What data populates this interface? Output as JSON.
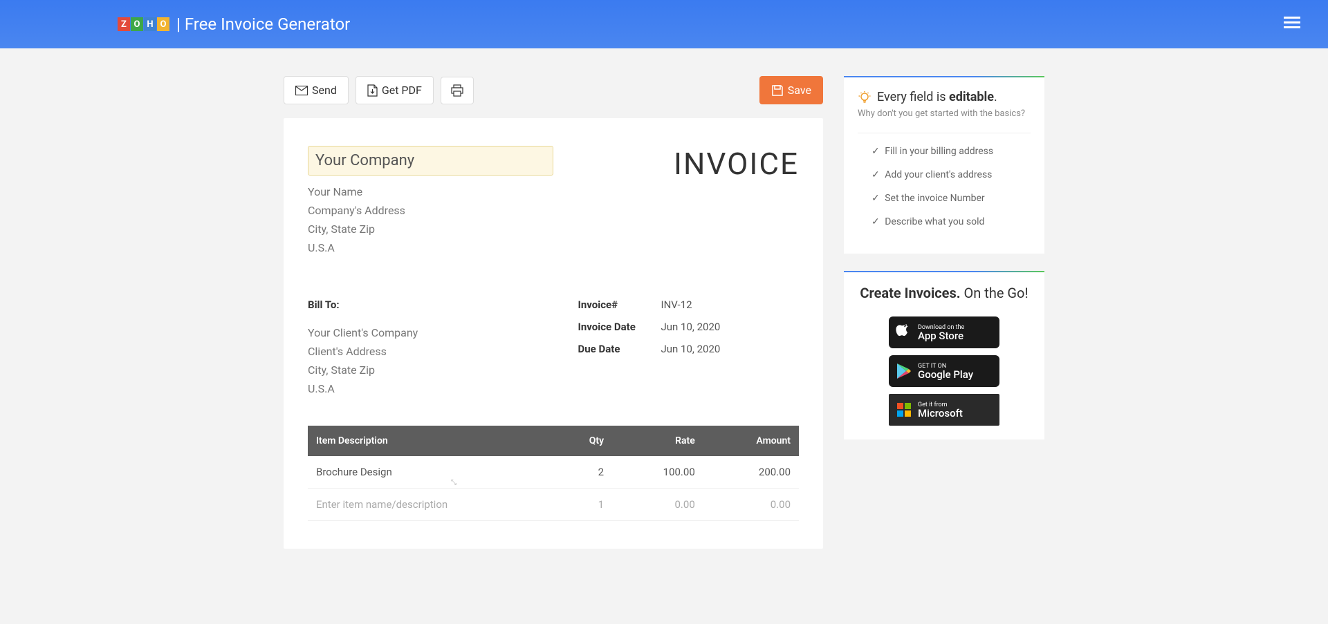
{
  "header": {
    "logo_letters": [
      "Z",
      "O",
      "H",
      "O"
    ],
    "title": "| Free Invoice Generator"
  },
  "toolbar": {
    "send": "Send",
    "get_pdf": "Get PDF",
    "save": "Save"
  },
  "invoice": {
    "company_placeholder": "Your Company",
    "your_name": "Your Name",
    "company_address": "Company's Address",
    "city_state_zip": "City, State Zip",
    "country": "U.S.A",
    "title": "INVOICE",
    "bill_to_label": "Bill To:",
    "client_company": "Your Client's Company",
    "client_address": "Client's Address",
    "client_city": "City, State Zip",
    "client_country": "U.S.A",
    "meta": {
      "number_label": "Invoice#",
      "number_value": "INV-12",
      "date_label": "Invoice Date",
      "date_value": "Jun 10, 2020",
      "due_label": "Due Date",
      "due_value": "Jun 10, 2020"
    },
    "table": {
      "headers": {
        "desc": "Item Description",
        "qty": "Qty",
        "rate": "Rate",
        "amount": "Amount"
      },
      "rows": [
        {
          "desc": "Brochure Design",
          "qty": "2",
          "rate": "100.00",
          "amount": "200.00"
        },
        {
          "desc": "Enter item name/description",
          "qty": "1",
          "rate": "0.00",
          "amount": "0.00",
          "placeholder": true
        }
      ]
    }
  },
  "tips": {
    "heading_prefix": "Every field is ",
    "heading_bold": "editable",
    "heading_suffix": ".",
    "sub": "Why don't you get started with the basics?",
    "items": [
      "Fill in your billing address",
      "Add your client's address",
      "Set the invoice Number",
      "Describe what you sold"
    ]
  },
  "promo": {
    "title_bold": "Create Invoices.",
    "title_rest": " On the Go!",
    "badges": {
      "apple_small": "Download on the",
      "apple_big": "App Store",
      "google_small": "GET IT ON",
      "google_big": "Google Play",
      "ms_small": "Get it from",
      "ms_big": "Microsoft"
    }
  }
}
